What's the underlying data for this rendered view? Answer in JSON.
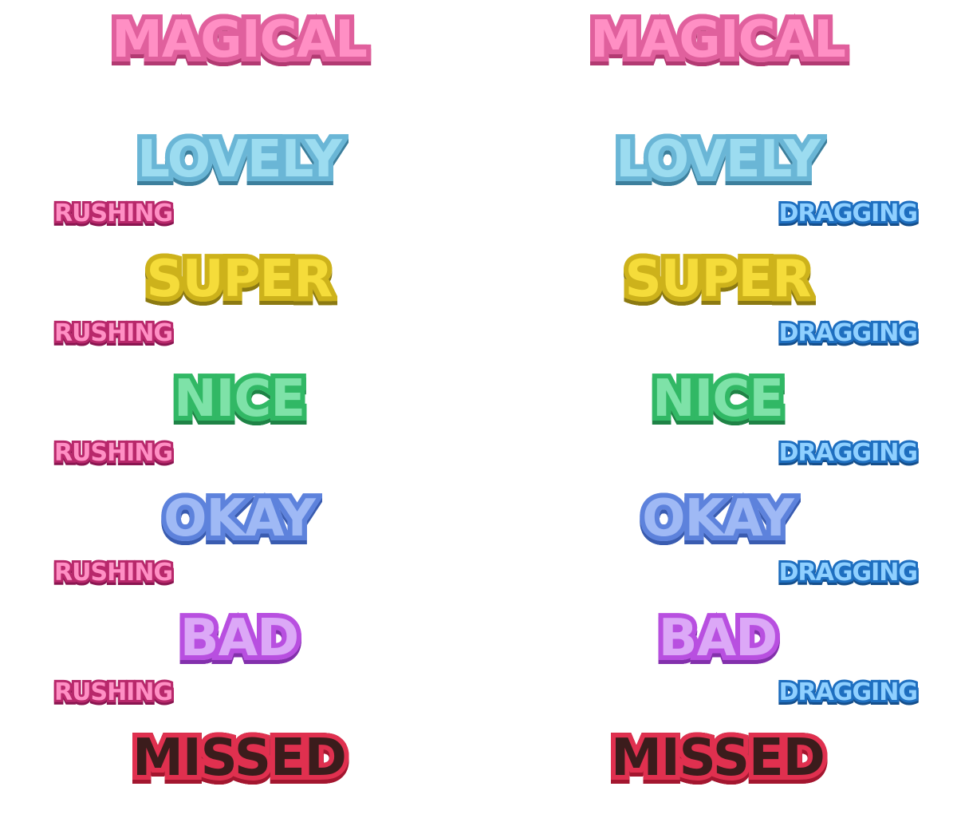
{
  "left_column": {
    "ratings": [
      "MAGICAL",
      "LOVELY",
      "SUPER",
      "NICE",
      "OKAY",
      "BAD",
      "MISSED"
    ],
    "timing_label": "RUSHING"
  },
  "right_column": {
    "ratings": [
      "MAGICAL",
      "LOVELY",
      "SUPER",
      "NICE",
      "OKAY",
      "BAD",
      "MISSED"
    ],
    "timing_label": "DRAGGING"
  },
  "colors": {
    "magical": "#ff8fc4",
    "lovely": "#9cdcf0",
    "super": "#f5dc3a",
    "nice": "#7ee2a8",
    "okay": "#9fb9f5",
    "bad": "#dca8f7",
    "missed": "#e0304f",
    "rushing": "#b8286b",
    "dragging": "#1e6fc0"
  }
}
